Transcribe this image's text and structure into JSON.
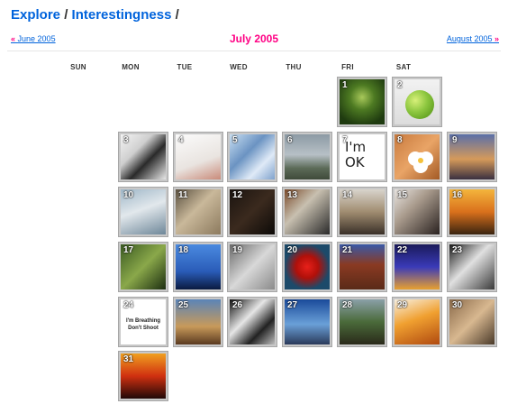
{
  "breadcrumb": {
    "explore": "Explore",
    "separator": "/",
    "interestingness": "Interestingness",
    "trailing": "/"
  },
  "month_nav": {
    "prev_label": "June 2005",
    "current_label": "July 2005",
    "next_label": "August 2005",
    "prev_arrow": "«",
    "next_arrow": "»"
  },
  "weekdays": [
    "SUN",
    "MON",
    "TUE",
    "WED",
    "THU",
    "FRI",
    "SAT"
  ],
  "days": [
    {
      "day": "1",
      "weekday_index": 5,
      "week": 0,
      "scene": "green-forest"
    },
    {
      "day": "2",
      "weekday_index": 6,
      "week": 0,
      "scene": "green-ball"
    },
    {
      "day": "3",
      "weekday_index": 1,
      "week": 1,
      "scene": "bw-portrait"
    },
    {
      "day": "4",
      "weekday_index": 2,
      "week": 1,
      "scene": "white-sketch"
    },
    {
      "day": "5",
      "weekday_index": 3,
      "week": 1,
      "scene": "blue-crystals"
    },
    {
      "day": "6",
      "weekday_index": 4,
      "week": 1,
      "scene": "grey-clouds"
    },
    {
      "day": "7",
      "weekday_index": 5,
      "week": 1,
      "scene": "im-ok-note",
      "caption": "I'm OK"
    },
    {
      "day": "8",
      "weekday_index": 6,
      "week": 1,
      "scene": "white-flower"
    },
    {
      "day": "9",
      "weekday_index": 7,
      "week": 1,
      "scene": "sunset-sea"
    },
    {
      "day": "10",
      "weekday_index": 1,
      "week": 2,
      "scene": "glass-still"
    },
    {
      "day": "11",
      "weekday_index": 2,
      "week": 2,
      "scene": "face-closeup"
    },
    {
      "day": "12",
      "weekday_index": 3,
      "week": 2,
      "scene": "dark-room"
    },
    {
      "day": "13",
      "weekday_index": 4,
      "week": 2,
      "scene": "rusty-metal"
    },
    {
      "day": "14",
      "weekday_index": 5,
      "week": 2,
      "scene": "water-drop"
    },
    {
      "day": "15",
      "weekday_index": 6,
      "week": 2,
      "scene": "girl-portrait"
    },
    {
      "day": "16",
      "weekday_index": 7,
      "week": 2,
      "scene": "golden-sunset"
    },
    {
      "day": "17",
      "weekday_index": 1,
      "week": 3,
      "scene": "green-plants"
    },
    {
      "day": "18",
      "weekday_index": 2,
      "week": 3,
      "scene": "blue-silhouettes"
    },
    {
      "day": "19",
      "weekday_index": 3,
      "week": 3,
      "scene": "grey-building"
    },
    {
      "day": "20",
      "weekday_index": 4,
      "week": 3,
      "scene": "red-flower"
    },
    {
      "day": "21",
      "weekday_index": 5,
      "week": 3,
      "scene": "brick-building"
    },
    {
      "day": "22",
      "weekday_index": 6,
      "week": 3,
      "scene": "lightning-night"
    },
    {
      "day": "23",
      "weekday_index": 7,
      "week": 3,
      "scene": "bw-architecture"
    },
    {
      "day": "24",
      "weekday_index": 1,
      "week": 4,
      "scene": "text-card",
      "caption": "I'm Breathing Don't Shoot"
    },
    {
      "day": "25",
      "weekday_index": 2,
      "week": 4,
      "scene": "desert-sky"
    },
    {
      "day": "26",
      "weekday_index": 3,
      "week": 4,
      "scene": "bw-curves"
    },
    {
      "day": "27",
      "weekday_index": 4,
      "week": 4,
      "scene": "blue-tower"
    },
    {
      "day": "28",
      "weekday_index": 5,
      "week": 4,
      "scene": "green-hills"
    },
    {
      "day": "29",
      "weekday_index": 6,
      "week": 4,
      "scene": "orange-drink"
    },
    {
      "day": "30",
      "weekday_index": 7,
      "week": 4,
      "scene": "sleeping-figure"
    },
    {
      "day": "31",
      "weekday_index": 1,
      "week": 5,
      "scene": "red-fire-sunset"
    }
  ],
  "colors": {
    "link_blue": "#0063dc",
    "accent_pink": "#ff0084"
  }
}
